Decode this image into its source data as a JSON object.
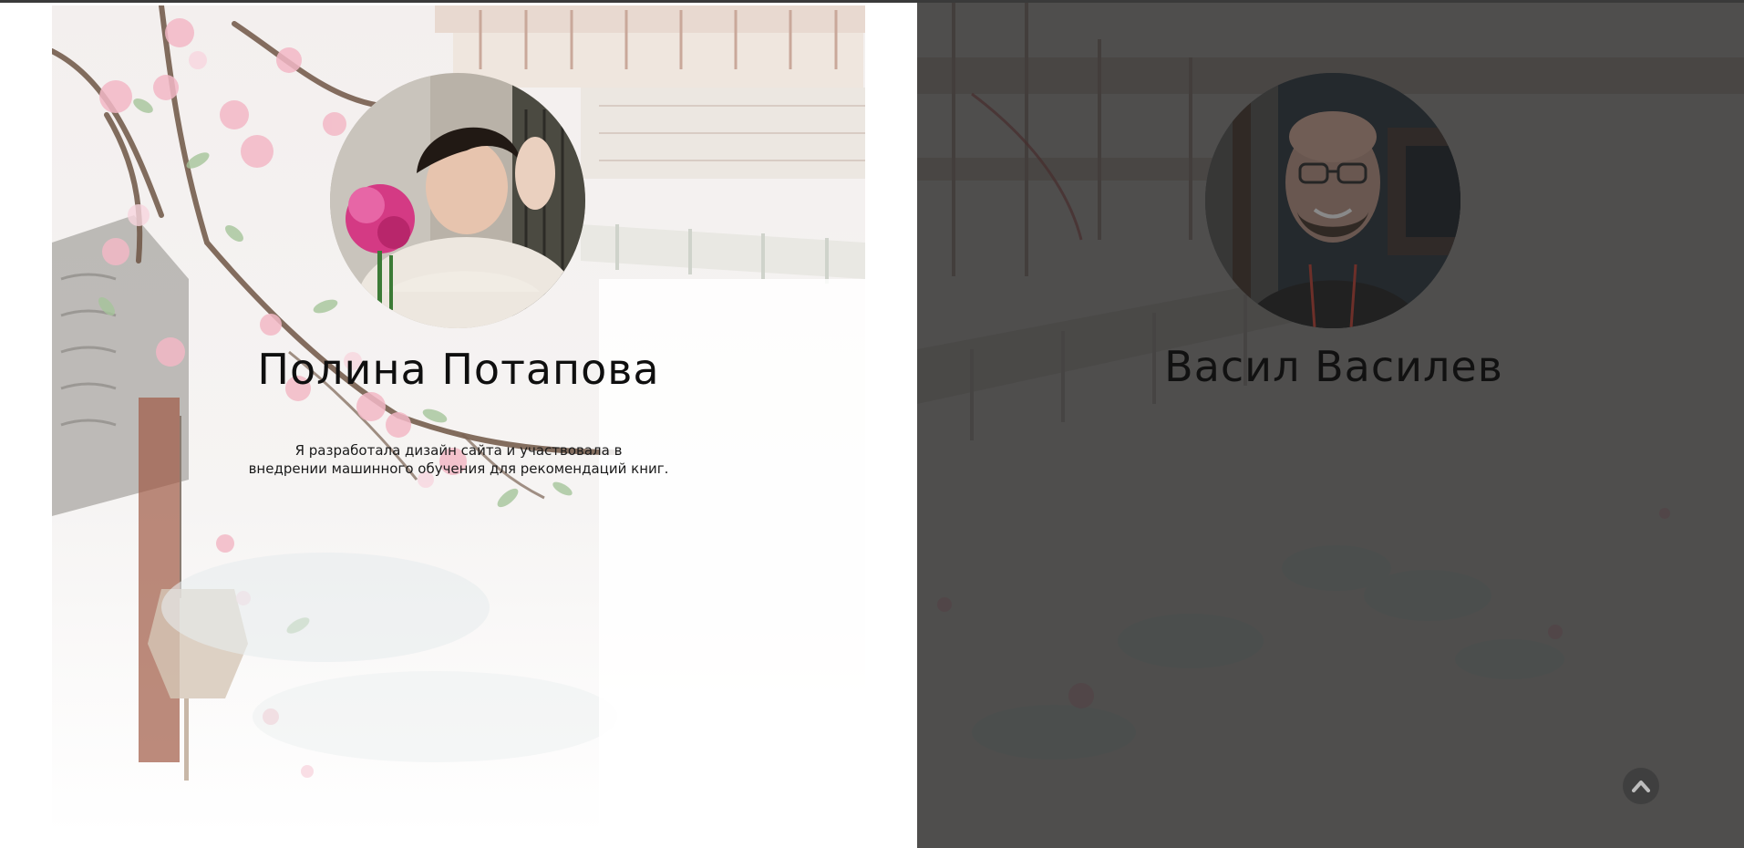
{
  "team": [
    {
      "name": "Полина Потапова",
      "description_line1": "Я разработала дизайн сайта и участвовала в",
      "description_line2": "внедрении машинного обучения для рекомендаций книг.",
      "photo": "portrait-with-peony-photo"
    },
    {
      "name": "Васил Василев",
      "photo": "smiling-man-with-glasses-photo"
    }
  ],
  "scroll_top": {
    "icon": "chevron-up-icon"
  },
  "colors": {
    "left_bg": "#ffffff",
    "right_overlay": "#2b2b2b",
    "name_text": "#0f0f0f",
    "button_bg": "#3f3f3f"
  }
}
